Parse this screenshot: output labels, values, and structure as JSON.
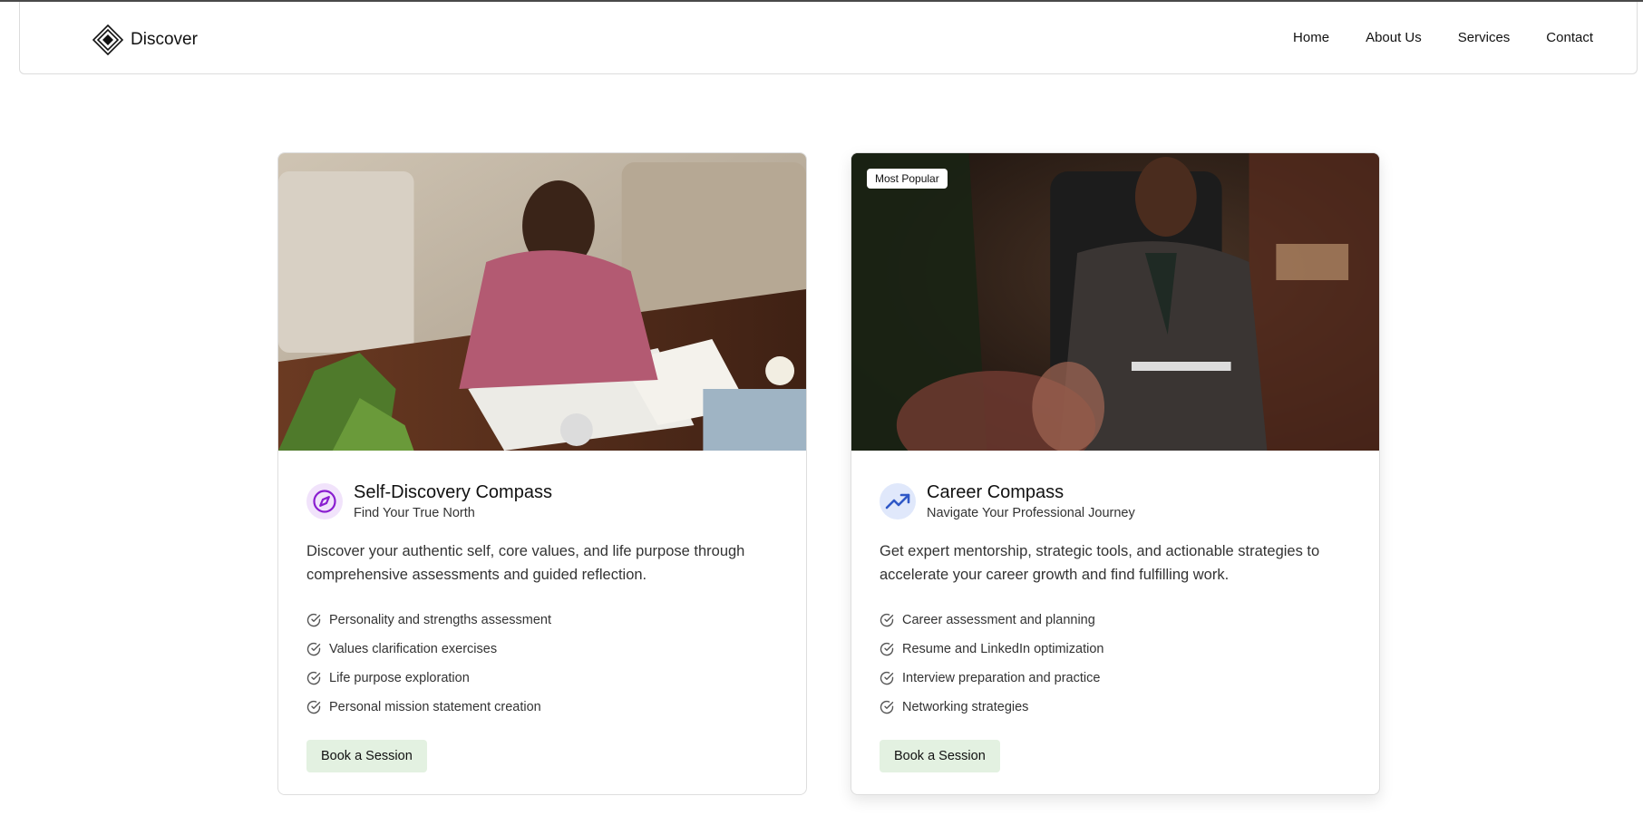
{
  "brand": {
    "name": "Discover",
    "logo_icon": "diamond-logo-icon"
  },
  "nav": {
    "items": [
      "Home",
      "About Us",
      "Services",
      "Contact"
    ]
  },
  "cards": [
    {
      "image_alt": "photo-woman-writing-journal",
      "badge": null,
      "icon": "compass-icon",
      "icon_color": "#8a1ed0",
      "title": "Self-Discovery Compass",
      "subtitle": "Find Your True North",
      "description": "Discover your authentic self, core values, and life purpose through comprehensive assessments and guided reflection.",
      "features": [
        "Personality and strengths assessment",
        "Values clarification exercises",
        "Life purpose exploration",
        "Personal mission statement creation"
      ],
      "button_label": "Book a Session"
    },
    {
      "image_alt": "photo-man-career-coaching",
      "badge": "Most Popular",
      "icon": "trending-up-icon",
      "icon_color": "#2f58c7",
      "title": "Career Compass",
      "subtitle": "Navigate Your Professional Journey",
      "description": "Get expert mentorship, strategic tools, and actionable strategies to accelerate your career growth and find fulfilling work.",
      "features": [
        "Career assessment and planning",
        "Resume and LinkedIn optimization",
        "Interview preparation and practice",
        "Networking strategies"
      ],
      "button_label": "Book a Session"
    }
  ],
  "colors": {
    "button_bg": "#e3f1e1",
    "check": "#555555"
  }
}
